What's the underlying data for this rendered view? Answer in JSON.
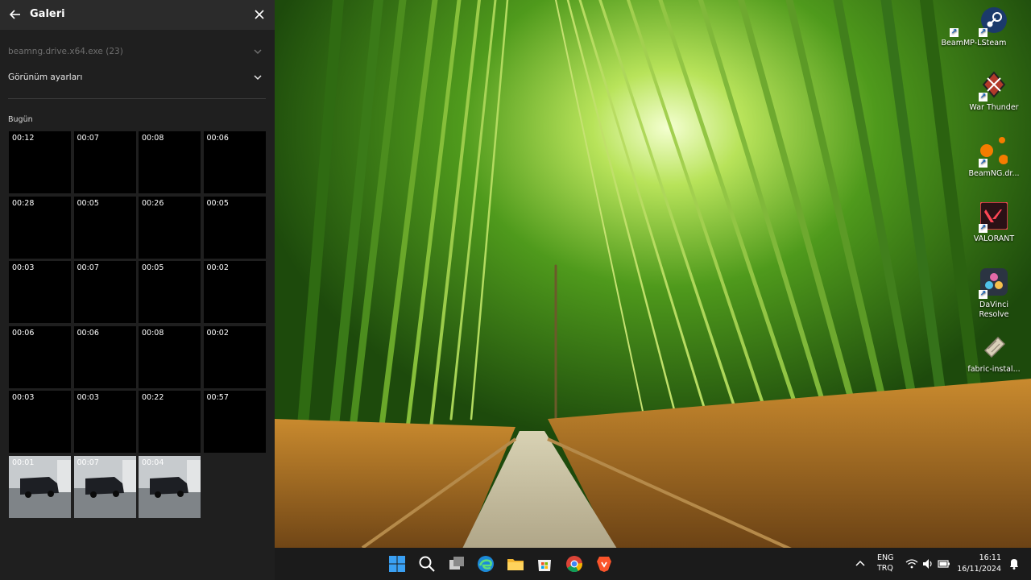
{
  "panel": {
    "title": "Galeri",
    "source_dropdown": "beamng.drive.x64.exe (23)",
    "view_settings": "Görünüm ayarları",
    "section_label": "Bugün",
    "clips": [
      {
        "duration": "00:12",
        "thumb": "black"
      },
      {
        "duration": "00:07",
        "thumb": "black"
      },
      {
        "duration": "00:08",
        "thumb": "black"
      },
      {
        "duration": "00:06",
        "thumb": "black"
      },
      {
        "duration": "00:28",
        "thumb": "black"
      },
      {
        "duration": "00:05",
        "thumb": "black"
      },
      {
        "duration": "00:26",
        "thumb": "black"
      },
      {
        "duration": "00:05",
        "thumb": "black"
      },
      {
        "duration": "00:03",
        "thumb": "black"
      },
      {
        "duration": "00:07",
        "thumb": "black"
      },
      {
        "duration": "00:05",
        "thumb": "black"
      },
      {
        "duration": "00:02",
        "thumb": "black"
      },
      {
        "duration": "00:06",
        "thumb": "black"
      },
      {
        "duration": "00:06",
        "thumb": "black"
      },
      {
        "duration": "00:08",
        "thumb": "black"
      },
      {
        "duration": "00:02",
        "thumb": "black"
      },
      {
        "duration": "00:03",
        "thumb": "black"
      },
      {
        "duration": "00:03",
        "thumb": "black"
      },
      {
        "duration": "00:22",
        "thumb": "black"
      },
      {
        "duration": "00:57",
        "thumb": "black"
      },
      {
        "duration": "00:01",
        "thumb": "van"
      },
      {
        "duration": "00:07",
        "thumb": "van"
      },
      {
        "duration": "00:04",
        "thumb": "van"
      }
    ]
  },
  "desktop_icons": [
    {
      "label": "BeamMP-L...",
      "icon": "beammp-launcher-icon"
    },
    {
      "label": "Steam",
      "icon": "steam-icon"
    },
    {
      "label": "War Thunder",
      "icon": "war-thunder-icon"
    },
    {
      "label": "BeamNG.dr...",
      "icon": "beamng-drive-icon"
    },
    {
      "label": "VALORANT",
      "icon": "valorant-icon"
    },
    {
      "label": "DaVinci Resolve",
      "icon": "davinci-resolve-icon"
    },
    {
      "label": "fabric-instal...",
      "icon": "fabric-installer-icon"
    }
  ],
  "taskbar": {
    "apps": [
      "windows-start-icon",
      "search-icon",
      "task-view-icon",
      "edge-icon",
      "file-explorer-icon",
      "microsoft-store-icon",
      "chrome-icon",
      "brave-icon"
    ],
    "lang_line1": "ENG",
    "lang_line2": "TRQ",
    "time": "16:11",
    "date": "16/11/2024"
  },
  "colors": {
    "panel_bg": "#1f1f1f",
    "panel_header_bg": "#2b2b2b",
    "taskbar_bg": "#1b1b1b",
    "valorant_red": "#ff4655",
    "beamng_orange": "#f57c00"
  }
}
